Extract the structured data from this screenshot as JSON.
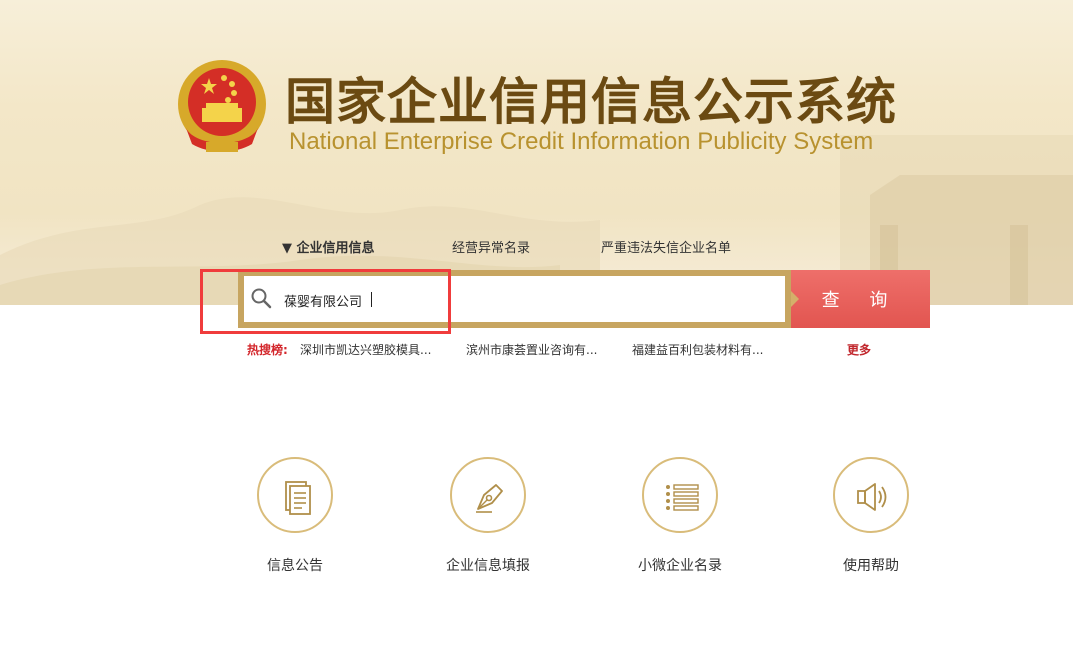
{
  "header": {
    "title_cn": "国家企业信用信息公示系统",
    "title_en": "National Enterprise Credit Information Publicity System"
  },
  "tabs": [
    {
      "label": "▼ 企业信用信息",
      "active": true
    },
    {
      "label": "经营异常名录",
      "active": false
    },
    {
      "label": "严重违法失信企业名单",
      "active": false
    }
  ],
  "search": {
    "value": "葆婴有限公司",
    "button_label": "查 询"
  },
  "hot_search": {
    "label": "热搜榜:",
    "items": [
      "深圳市凯达兴塑胶模具...",
      "滨州市康荟置业咨询有...",
      "福建益百利包装材料有..."
    ],
    "more": "更多"
  },
  "features": [
    {
      "label": "信息公告",
      "icon": "document-icon"
    },
    {
      "label": "企业信息填报",
      "icon": "pen-nib-icon"
    },
    {
      "label": "小微企业名录",
      "icon": "list-icon"
    },
    {
      "label": "使用帮助",
      "icon": "speaker-icon"
    }
  ],
  "colors": {
    "brand_gold": "#c7a560",
    "title_brown": "#6b4a12",
    "button_red": "#e25550",
    "highlight_red": "#f03c3c"
  }
}
